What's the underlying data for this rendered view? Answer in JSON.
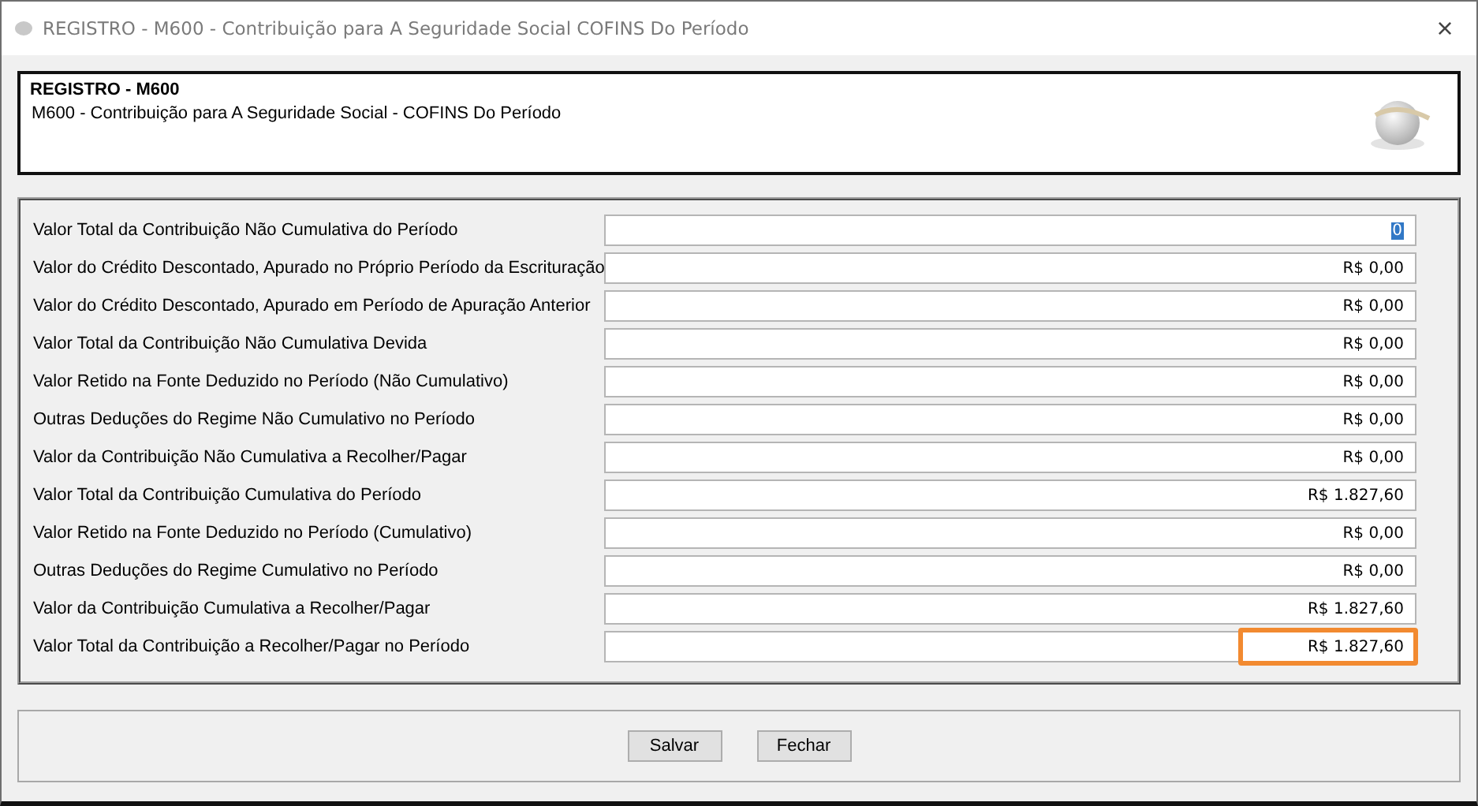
{
  "window": {
    "title": "REGISTRO - M600 - Contribuição para A Seguridade Social  COFINS Do Período",
    "close": "×"
  },
  "header": {
    "title": "REGISTRO - M600",
    "subtitle": "M600 - Contribuição para A Seguridade Social - COFINS Do Período"
  },
  "fields": [
    {
      "label": "Valor Total da Contribuição Não Cumulativa do Período",
      "value": "0",
      "text_selected": true,
      "highlighted": false
    },
    {
      "label": "Valor do Crédito Descontado, Apurado no Próprio Período da Escrituração",
      "value": "R$ 0,00",
      "text_selected": false,
      "highlighted": false
    },
    {
      "label": "Valor do Crédito Descontado, Apurado em Período de Apuração Anterior",
      "value": "R$ 0,00",
      "text_selected": false,
      "highlighted": false
    },
    {
      "label": "Valor Total da Contribuição Não Cumulativa Devida",
      "value": "R$ 0,00",
      "text_selected": false,
      "highlighted": false
    },
    {
      "label": "Valor Retido na Fonte Deduzido no Período (Não Cumulativo)",
      "value": "R$ 0,00",
      "text_selected": false,
      "highlighted": false
    },
    {
      "label": "Outras Deduções do Regime Não Cumulativo no Período",
      "value": "R$ 0,00",
      "text_selected": false,
      "highlighted": false
    },
    {
      "label": "Valor da Contribuição Não Cumulativa a Recolher/Pagar",
      "value": "R$ 0,00",
      "text_selected": false,
      "highlighted": false
    },
    {
      "label": "Valor Total da Contribuição Cumulativa do Período",
      "value": "R$ 1.827,60",
      "text_selected": false,
      "highlighted": false
    },
    {
      "label": "Valor Retido na Fonte Deduzido no Período (Cumulativo)",
      "value": "R$ 0,00",
      "text_selected": false,
      "highlighted": false
    },
    {
      "label": "Outras Deduções do Regime Cumulativo no Período",
      "value": "R$ 0,00",
      "text_selected": false,
      "highlighted": false
    },
    {
      "label": "Valor da Contribuição Cumulativa a Recolher/Pagar",
      "value": "R$ 1.827,60",
      "text_selected": false,
      "highlighted": false
    },
    {
      "label": "Valor Total da Contribuição a Recolher/Pagar no Período",
      "value": "R$ 1.827,60",
      "text_selected": false,
      "highlighted": true
    }
  ],
  "buttons": [
    "Salvar",
    "Fechar"
  ]
}
